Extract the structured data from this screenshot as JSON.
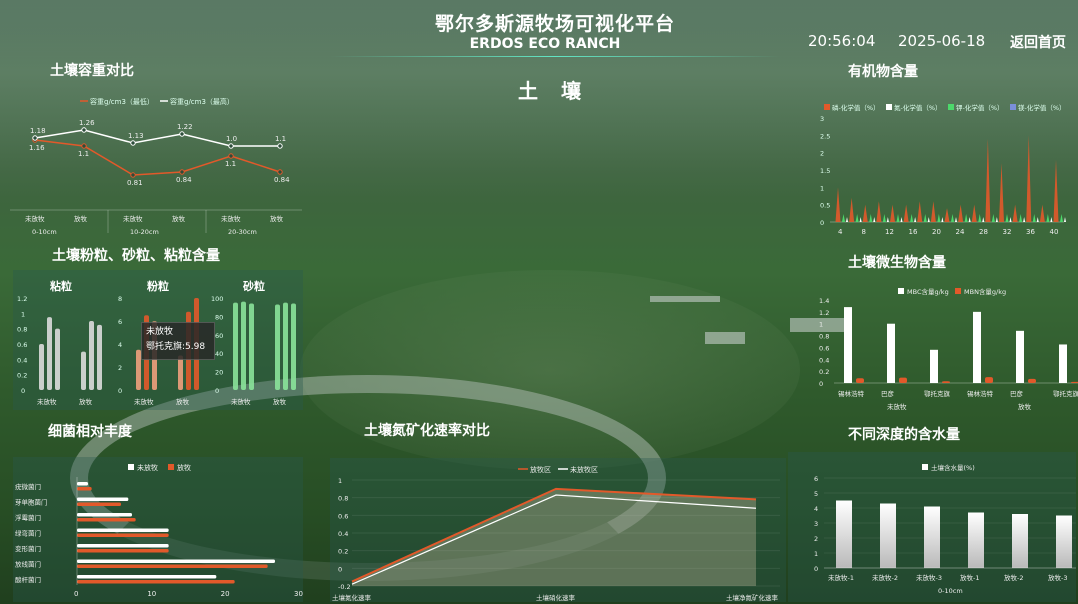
{
  "header": {
    "title": "鄂尔多斯源牧场可视化平台",
    "subtitle": "ERDOS ECO RANCH",
    "time": "20:56:04",
    "date": "2025-06-18",
    "back_label": "返回首页"
  },
  "center_title": "土  壤",
  "bulk_density": {
    "title": "土壤容重对比",
    "type": "line",
    "series": [
      {
        "name": "容重g/cm3（最低）",
        "values": [
          1.16,
          1.1,
          0.81,
          0.84,
          1.0,
          0.84
        ],
        "labels": [
          "1.16",
          "1.1",
          "0.81",
          "0.84",
          "1.1",
          "0.84"
        ]
      },
      {
        "name": "容重g/cm3（最高）",
        "values": [
          1.18,
          1.26,
          1.13,
          1.22,
          1.1,
          1.1
        ],
        "labels": [
          "1.18",
          "1.26",
          "1.13",
          "1.22",
          "1.0",
          "1.1"
        ]
      }
    ],
    "categories": [
      "未放牧",
      "放牧",
      "未放牧",
      "放牧",
      "未放牧",
      "放牧"
    ],
    "groups": [
      "0-10cm",
      "10-20cm",
      "20-30cm"
    ],
    "colors": {
      "low": "#e2592a",
      "high": "#ffffff"
    }
  },
  "texture": {
    "title": "土壤粉粒、砂粒、粘粒含量",
    "charts": [
      {
        "name": "粘粒",
        "yticks": [
          "1.2",
          "1",
          "0.8",
          "0.6",
          "0.4",
          "0.2",
          "0"
        ],
        "xlabels": [
          "未放牧",
          "放牧"
        ],
        "values": [
          [
            0.6,
            0.95,
            0.8
          ],
          [
            0.5,
            0.9,
            0.85
          ]
        ],
        "max": 1.2
      },
      {
        "name": "粉粒",
        "yticks": [
          "8",
          "6",
          "4",
          "2",
          "0"
        ],
        "xlabels": [
          "未放牧",
          "放牧"
        ],
        "values": [
          [
            3.5,
            6.5,
            5.98
          ],
          [
            3,
            6.8,
            8.0
          ]
        ],
        "max": 8
      },
      {
        "name": "砂粒",
        "yticks": [
          "100",
          "80",
          "60",
          "40",
          "20",
          "0"
        ],
        "xlabels": [
          "未放牧",
          "放牧"
        ],
        "values": [
          [
            95,
            96,
            94
          ],
          [
            93,
            95,
            94
          ]
        ],
        "max": 100
      }
    ],
    "tooltip": {
      "line1": "未放牧",
      "line2": "鄂托克旗:5.98"
    }
  },
  "bacteria": {
    "title": "细菌相对丰度",
    "legend": [
      "未放牧",
      "放牧"
    ],
    "categories": [
      "疣微菌门",
      "芽单胞菌门",
      "浮霉菌门",
      "绿弯菌门",
      "变形菌门",
      "放线菌门",
      "酸杆菌门"
    ],
    "series": [
      {
        "name": "未放牧",
        "values": [
          1.5,
          7,
          7.5,
          12.5,
          12.5,
          27,
          19
        ]
      },
      {
        "name": "放牧",
        "values": [
          2,
          6,
          8,
          12.5,
          12.5,
          26,
          21.5
        ]
      }
    ],
    "xticks": [
      "0",
      "10",
      "20",
      "30"
    ],
    "colors": {
      "a": "#ffffff",
      "b": "#e2592a"
    }
  },
  "nitrogen": {
    "title": "土壤氮矿化速率对比",
    "legend": [
      "放牧区",
      "未放牧区"
    ],
    "categories": [
      "土壤氮化速率",
      "土壤硝化速率",
      "土壤净氮矿化速率"
    ],
    "series": [
      {
        "name": "放牧区",
        "values": [
          -0.15,
          0.9,
          0.78
        ]
      },
      {
        "name": "未放牧区",
        "values": [
          -0.18,
          0.83,
          0.68
        ]
      }
    ],
    "yticks": [
      "1",
      "0.8",
      "0.6",
      "0.4",
      "0.2",
      "0",
      "-0.2"
    ]
  },
  "organic": {
    "title": "有机物含量",
    "legend": [
      "磷-化学值（%）",
      "氮-化学值（%）",
      "钾-化学值（%）",
      "镁-化学值（%）"
    ],
    "xticks": [
      "4",
      "8",
      "12",
      "16",
      "20",
      "24",
      "28",
      "32",
      "36",
      "40"
    ],
    "yticks": [
      "3",
      "2.5",
      "2",
      "1.5",
      "1",
      "0.5",
      "0"
    ],
    "phos_values": [
      1.0,
      0.7,
      0.5,
      0.6,
      0.5,
      0.5,
      0.6,
      0.6,
      0.4,
      0.5,
      0.5,
      2.4,
      1.7,
      0.5,
      2.5,
      0.5,
      1.8
    ],
    "colors": [
      "#e2592a",
      "#ffffff",
      "#4cd96b",
      "#7a8fd9"
    ]
  },
  "microbes": {
    "title": "土壤微生物含量",
    "legend": [
      "MBC含量g/kg",
      "MBN含量g/kg"
    ],
    "yticks": [
      "1.4",
      "1.2",
      "1",
      "0.8",
      "0.6",
      "0.4",
      "0.2",
      "0"
    ],
    "categories": [
      "锡林浩特",
      "巴彦",
      "鄂托克旗",
      "锡林浩特",
      "巴彦",
      "鄂托克旗"
    ],
    "groups": [
      "未放牧",
      "放牧"
    ],
    "mbc": [
      1.28,
      1.0,
      0.56,
      1.2,
      0.88,
      0.65
    ],
    "mbn": [
      0.08,
      0.09,
      0.03,
      0.1,
      0.07,
      0.02
    ]
  },
  "moisture": {
    "title": "不同深度的含水量",
    "legend": [
      "土壤含水量(%)"
    ],
    "yticks": [
      "6",
      "5",
      "4",
      "3",
      "2",
      "1",
      "0"
    ],
    "categories": [
      "未放牧-1",
      "未放牧-2",
      "未放牧-3",
      "放牧-1",
      "放牧-2",
      "放牧-3"
    ],
    "group": "0-10cm",
    "values": [
      4.5,
      4.3,
      4.1,
      3.7,
      3.6,
      3.5
    ]
  }
}
